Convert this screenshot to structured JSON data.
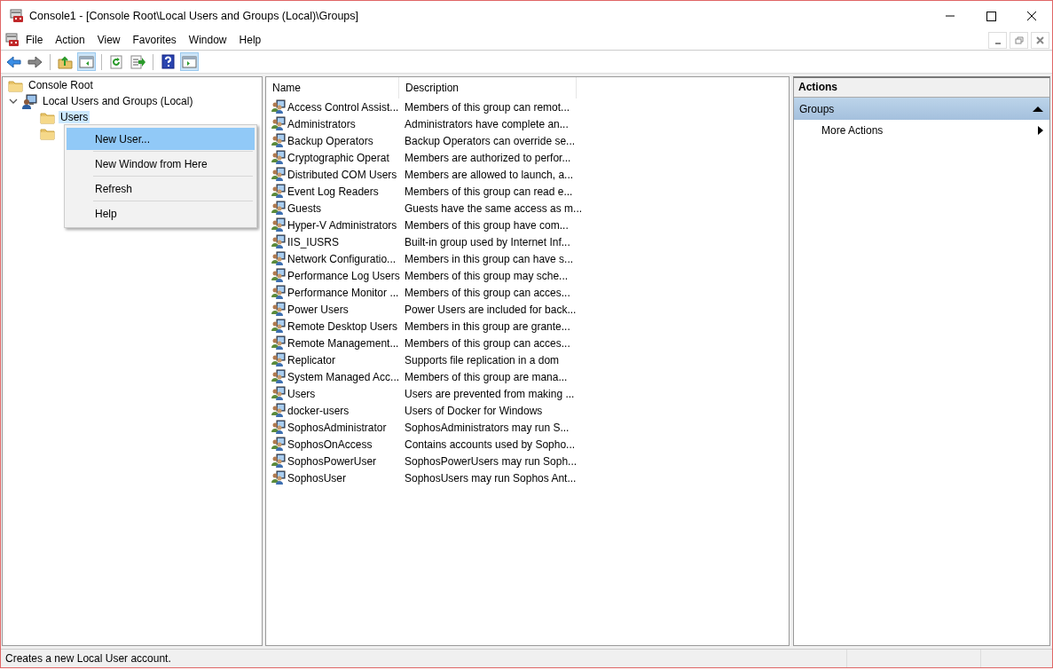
{
  "window": {
    "title": "Console1 - [Console Root\\Local Users and Groups (Local)\\Groups]"
  },
  "menu": [
    "File",
    "Action",
    "View",
    "Favorites",
    "Window",
    "Help"
  ],
  "toolbar": [
    {
      "kind": "back",
      "pressed": false
    },
    {
      "kind": "forward",
      "pressed": false
    },
    {
      "kind": "up",
      "pressed": false
    },
    {
      "kind": "tree-pane",
      "pressed": true
    },
    {
      "kind": "refresh",
      "pressed": false
    },
    {
      "kind": "export",
      "pressed": false
    },
    {
      "kind": "help",
      "pressed": false
    },
    {
      "kind": "action-pane",
      "pressed": true
    }
  ],
  "tree": [
    {
      "label": "Console Root",
      "kind": "folder"
    },
    {
      "label": "Local Users and Groups (Local)",
      "kind": "computer",
      "expanded": true,
      "children": [
        {
          "label": "Users",
          "kind": "folder",
          "selected": true
        },
        {
          "kind": "folder",
          "selected": false
        }
      ]
    }
  ],
  "context_menu": [
    {
      "label": "New User...",
      "selected": true
    },
    {
      "label": "New Window from Here",
      "selected": false
    },
    {
      "label": "Refresh",
      "selected": false
    },
    {
      "label": "Help",
      "selected": false
    }
  ],
  "table": {
    "columns": [
      "Name",
      "Description"
    ],
    "rows": [
      [
        "Access Control Assist...",
        "Members of this group can remot..."
      ],
      [
        "Administrators",
        "Administrators have complete an..."
      ],
      [
        "Backup Operators",
        "Backup Operators can override se..."
      ],
      [
        "Cryptographic Operat",
        "Members are authorized to perfor..."
      ],
      [
        "Distributed COM Users",
        "Members are allowed to launch, a..."
      ],
      [
        "Event Log Readers",
        "Members of this group can read e..."
      ],
      [
        "Guests",
        "Guests have the same access as m..."
      ],
      [
        "Hyper-V Administrators",
        "Members of this group have com..."
      ],
      [
        "IIS_IUSRS",
        "Built-in group used by Internet Inf..."
      ],
      [
        "Network Configuratio...",
        "Members in this group can have s..."
      ],
      [
        "Performance Log Users",
        "Members of this group may sche..."
      ],
      [
        "Performance Monitor ...",
        "Members of this group can acces..."
      ],
      [
        "Power Users",
        "Power Users are included for back..."
      ],
      [
        "Remote Desktop Users",
        "Members in this group are grante..."
      ],
      [
        "Remote Management...",
        "Members of this group can acces..."
      ],
      [
        "Replicator",
        "Supports file replication in a dom"
      ],
      [
        "System Managed Acc...",
        "Members of this group are mana..."
      ],
      [
        "Users",
        "Users are prevented from making ..."
      ],
      [
        "docker-users",
        "Users of Docker for Windows"
      ],
      [
        "SophosAdministrator",
        "SophosAdministrators may run S..."
      ],
      [
        "SophosOnAccess",
        "Contains accounts used by Sopho..."
      ],
      [
        "SophosPowerUser",
        "SophosPowerUsers may run Soph..."
      ],
      [
        "SophosUser",
        "SophosUsers may run Sophos Ant..."
      ]
    ]
  },
  "actions": {
    "title": "Actions",
    "sections": [
      {
        "title": "Groups",
        "expanded": true,
        "items": [
          {
            "label": "More Actions",
            "submenu": true
          }
        ]
      }
    ]
  },
  "status_bar": "Creates a new Local User account."
}
